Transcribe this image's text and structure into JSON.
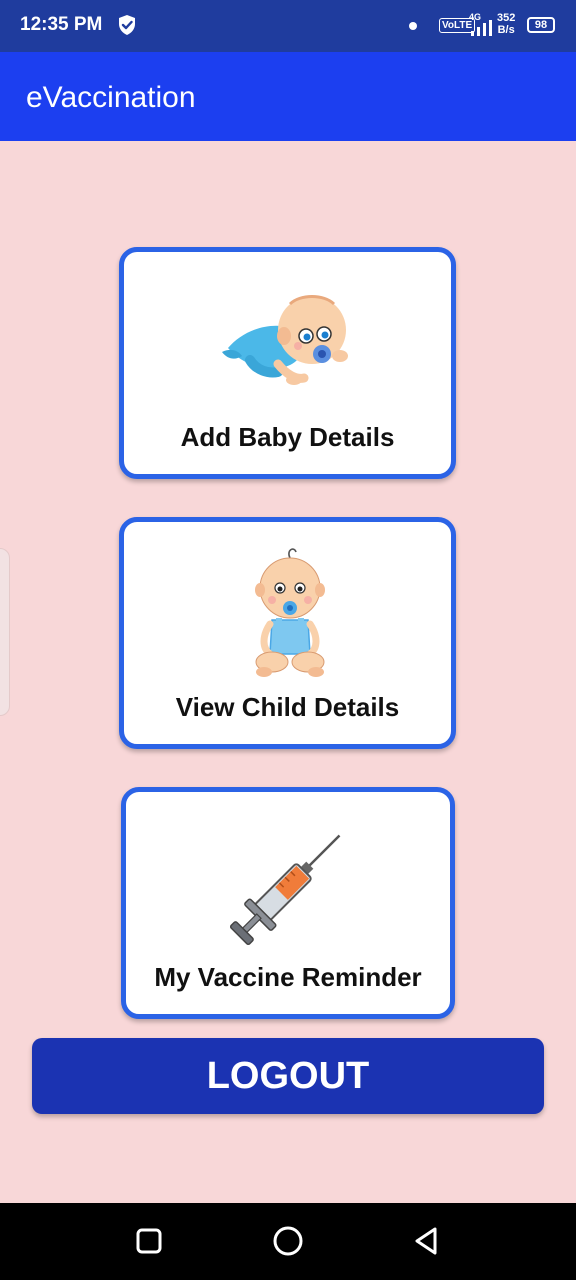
{
  "status_bar": {
    "time": "12:35 PM",
    "volte": "VoLTE",
    "network": "4G",
    "speed_value": "352",
    "speed_unit": "B/s",
    "battery": "98",
    "icons": [
      "shield-check-icon",
      "notification-dot-icon",
      "signal-icon",
      "battery-icon"
    ]
  },
  "app_bar": {
    "title": "eVaccination"
  },
  "cards": [
    {
      "label": "Add Baby Details",
      "icon": "crawling-baby-icon"
    },
    {
      "label": "View Child Details",
      "icon": "sitting-baby-icon"
    },
    {
      "label": "My Vaccine Reminder",
      "icon": "syringe-icon"
    }
  ],
  "logout_label": "LOGOUT",
  "nav_bar": {
    "icons": [
      "recents-square-icon",
      "home-circle-icon",
      "back-triangle-icon"
    ]
  },
  "colors": {
    "status_bar": "#1f3c9e",
    "app_bar": "#1c3ff0",
    "background": "#f8d7d8",
    "card_border": "#2b63e6",
    "logout": "#1b33b2"
  }
}
